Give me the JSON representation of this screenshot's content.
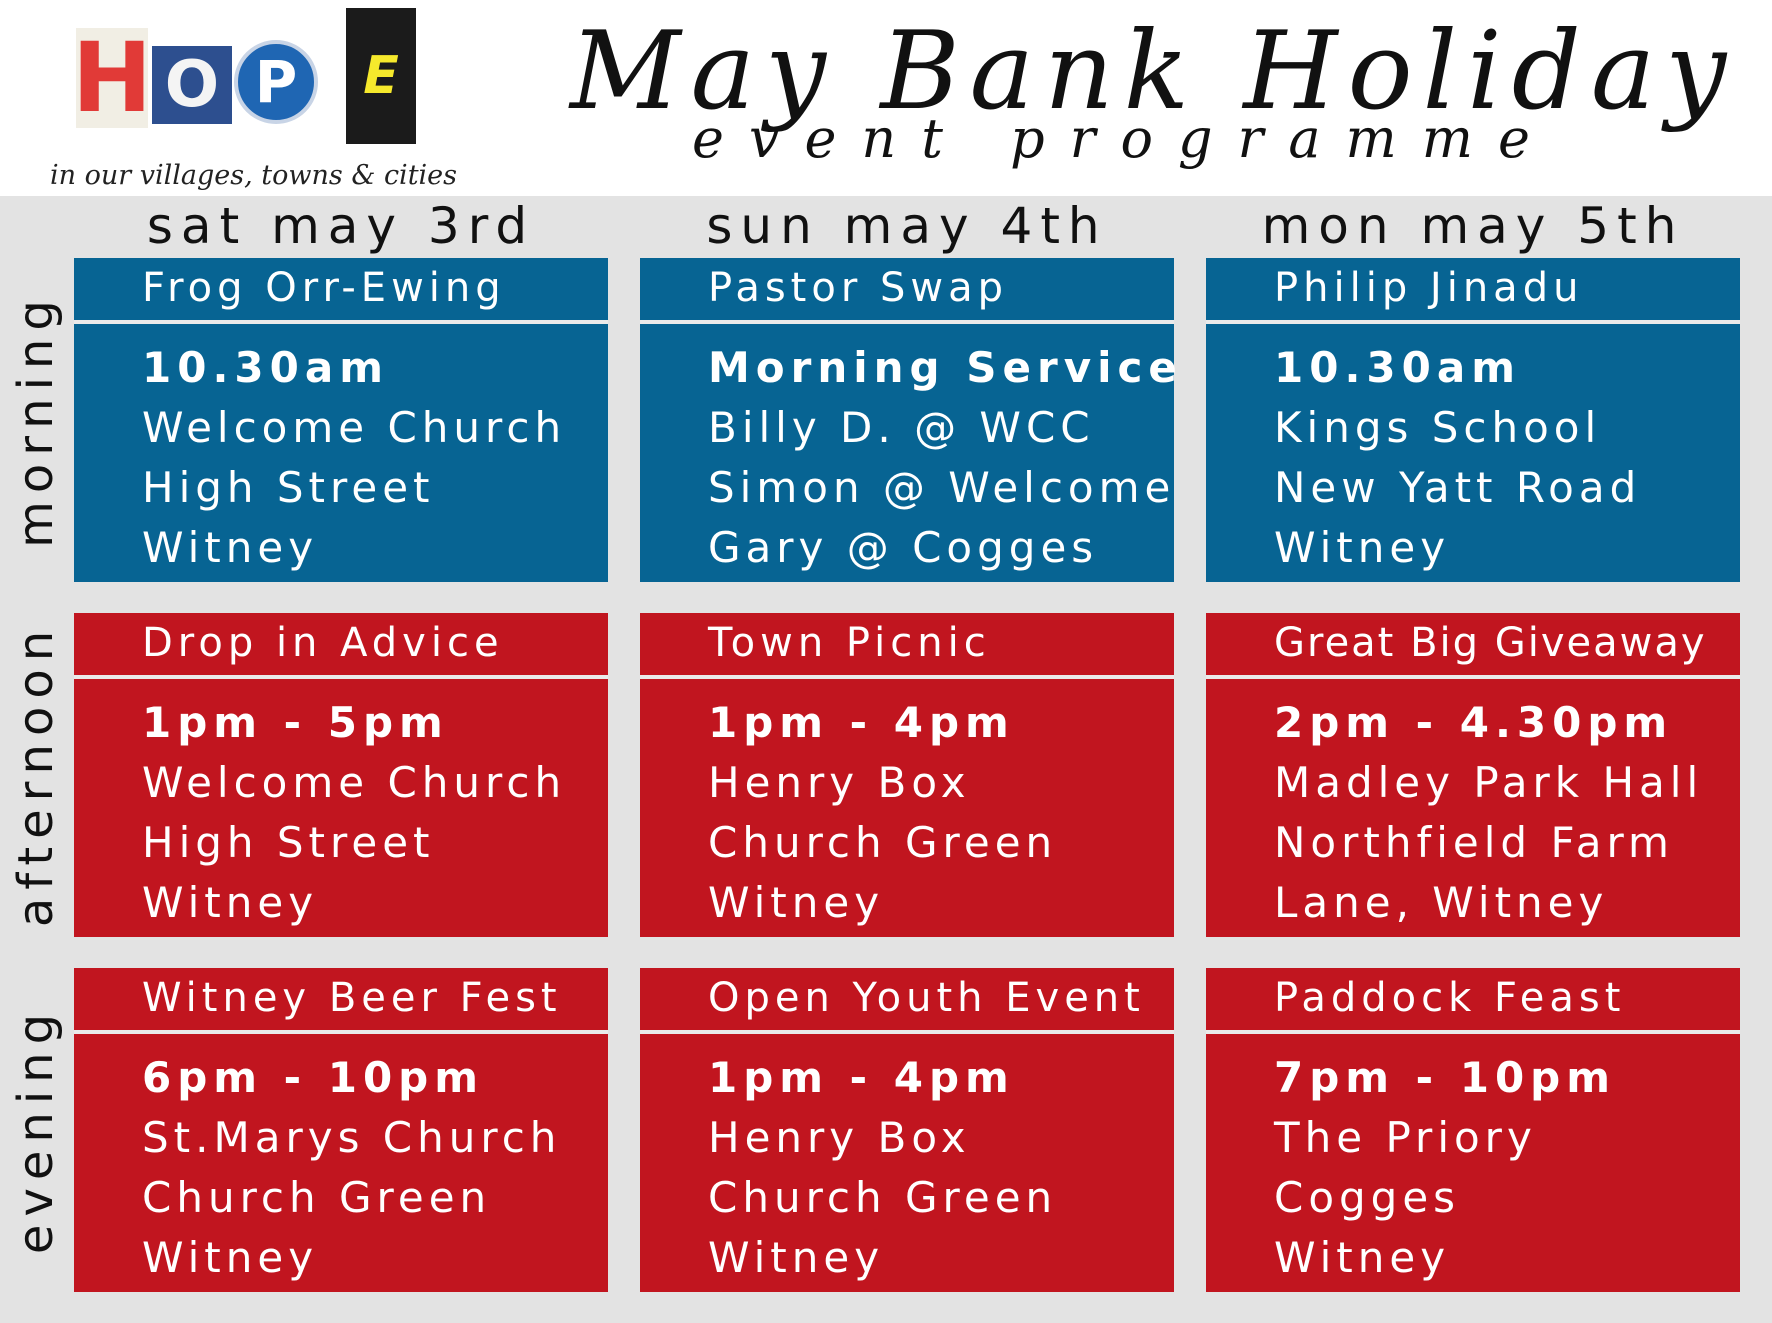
{
  "header": {
    "logo": {
      "letters": [
        "H",
        "O",
        "P",
        "E"
      ]
    },
    "tagline": "in our villages, towns & cities",
    "title": "May Bank Holiday",
    "subtitle": "event programme"
  },
  "days": [
    "sat may 3rd",
    "sun may 4th",
    "mon may 5th"
  ],
  "periods": [
    {
      "label": "morning",
      "color": "#076493",
      "events": [
        {
          "title": "Frog Orr-Ewing",
          "time": "10.30am",
          "lines": [
            "Welcome Church",
            "High Street",
            "Witney"
          ]
        },
        {
          "title": "Pastor Swap",
          "time": "Morning Service",
          "lines": [
            "Billy D. @ WCC",
            "Simon @ Welcome",
            "Gary @ Cogges"
          ]
        },
        {
          "title": "Philip Jinadu",
          "time": "10.30am",
          "lines": [
            "Kings School",
            "New Yatt Road",
            "Witney"
          ]
        }
      ]
    },
    {
      "label": "afternoon",
      "color": "#c1151f",
      "events": [
        {
          "title": "Drop in Advice",
          "time": "1pm - 5pm",
          "lines": [
            "Welcome Church",
            "High Street",
            "Witney"
          ]
        },
        {
          "title": "Town Picnic",
          "time": "1pm - 4pm",
          "lines": [
            "Henry Box",
            "Church Green",
            "Witney"
          ]
        },
        {
          "title": "Great Big Giveaway",
          "time": "2pm - 4.30pm",
          "lines": [
            "Madley Park Hall",
            "Northfield Farm",
            "Lane, Witney"
          ]
        }
      ]
    },
    {
      "label": "evening",
      "color": "#c1151f",
      "events": [
        {
          "title": "Witney Beer Fest",
          "time": "6pm - 10pm",
          "lines": [
            "St.Marys Church",
            "Church Green",
            "Witney"
          ]
        },
        {
          "title": "Open Youth Event",
          "time": "1pm - 4pm",
          "lines": [
            "Henry Box",
            "Church Green",
            "Witney"
          ]
        },
        {
          "title": "Paddock Feast",
          "time": "7pm - 10pm",
          "lines": [
            "The Priory",
            "Cogges",
            "Witney"
          ]
        }
      ]
    }
  ]
}
